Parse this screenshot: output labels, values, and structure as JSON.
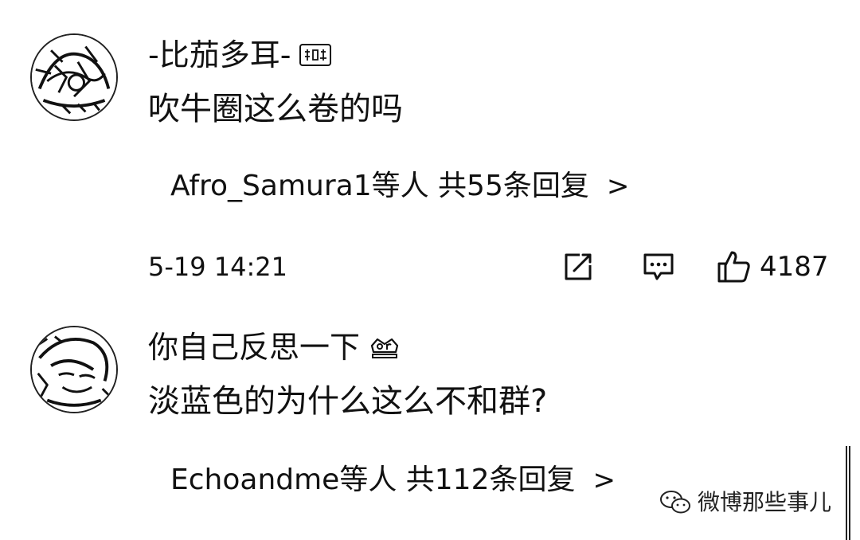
{
  "comments": [
    {
      "username": "-比茄多耳-",
      "badge_icon": "fan-badge-icon",
      "text": "吹牛圈这么卷的吗",
      "replies_label": "Afro_Samura1等人  共55条回复",
      "replies_chevron": ">",
      "timestamp": "5-19 14:21",
      "likes": "4187"
    },
    {
      "username": "你自己反思一下",
      "badge_icon": "crown-badge-icon",
      "text": "淡蓝色的为什么这么不和群?",
      "replies_label": "Echoandme等人  共112条回复",
      "replies_chevron": ">"
    }
  ],
  "watermark": {
    "text": "微博那些事儿",
    "icon": "wechat-icon"
  },
  "colors": {
    "text": "#111111",
    "background": "#ffffff"
  }
}
